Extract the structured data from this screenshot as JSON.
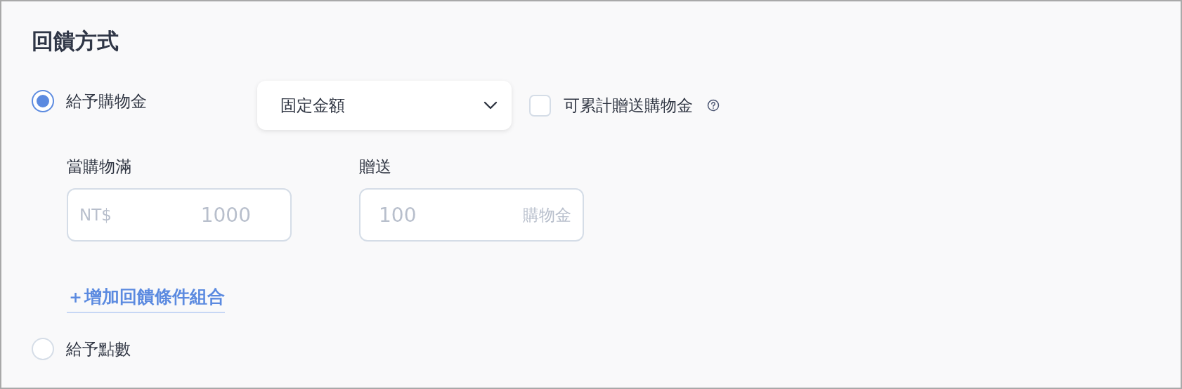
{
  "section_title": "回饋方式",
  "options": [
    {
      "label": "給予購物金",
      "selected": true,
      "dropdown": {
        "value": "固定金額"
      },
      "checkbox": {
        "label": "可累計贈送購物金",
        "checked": false
      },
      "fields": [
        {
          "label": "當購物滿",
          "prefix": "NT$",
          "placeholder": "1000"
        },
        {
          "label": "贈送",
          "placeholder": "100",
          "suffix": "購物金"
        }
      ],
      "add_link": "＋增加回饋條件組合"
    },
    {
      "label": "給予點數",
      "selected": false
    }
  ]
}
